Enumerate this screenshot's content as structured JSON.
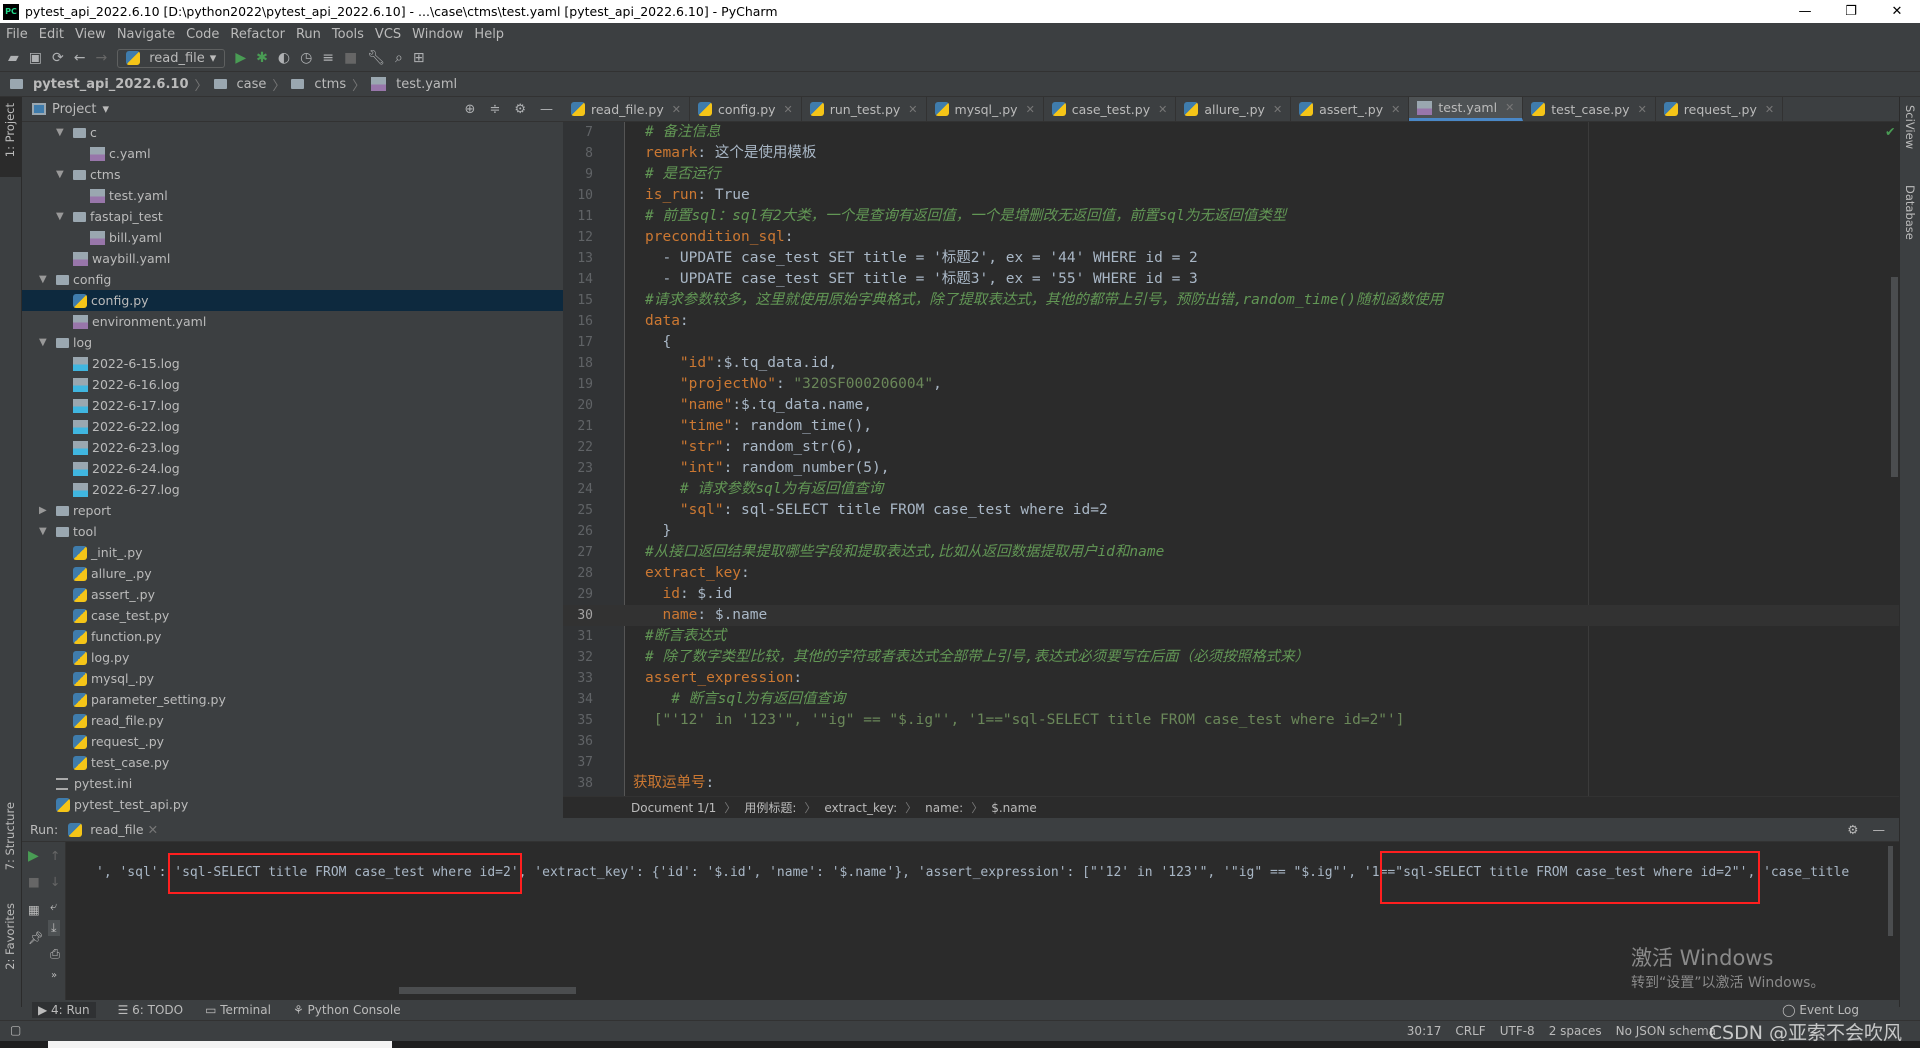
{
  "window": {
    "title": "pytest_api_2022.6.10 [D:\\python2022\\pytest_api_2022.6.10] - ...\\case\\ctms\\test.yaml [pytest_api_2022.6.10] - PyCharm",
    "logo": "PC"
  },
  "menu": [
    "File",
    "Edit",
    "View",
    "Navigate",
    "Code",
    "Refactor",
    "Run",
    "Tools",
    "VCS",
    "Window",
    "Help"
  ],
  "toolbar": {
    "run_config": "read_file"
  },
  "navbar": {
    "project": "pytest_api_2022.6.10",
    "crumbs": [
      "case",
      "ctms",
      "test.yaml"
    ]
  },
  "leftstrip": {
    "project": "1: Project",
    "structure": "7: Structure",
    "favorites": "2: Favorites"
  },
  "rightstrip": {
    "sciview": "SciView",
    "database": "Database"
  },
  "project_panel": {
    "title": "Project"
  },
  "tree": [
    {
      "label": "c",
      "depth": 2,
      "type": "folder",
      "open": true
    },
    {
      "label": "c.yaml",
      "depth": 3,
      "type": "yaml"
    },
    {
      "label": "ctms",
      "depth": 2,
      "type": "folder",
      "open": true
    },
    {
      "label": "test.yaml",
      "depth": 3,
      "type": "yaml"
    },
    {
      "label": "fastapi_test",
      "depth": 2,
      "type": "folder",
      "open": true
    },
    {
      "label": "bill.yaml",
      "depth": 3,
      "type": "yaml"
    },
    {
      "label": "waybill.yaml",
      "depth": 2,
      "type": "yaml"
    },
    {
      "label": "config",
      "depth": 1,
      "type": "folder",
      "open": true
    },
    {
      "label": "config.py",
      "depth": 2,
      "type": "py",
      "selected": true
    },
    {
      "label": "environment.yaml",
      "depth": 2,
      "type": "yaml"
    },
    {
      "label": "log",
      "depth": 1,
      "type": "folder",
      "open": true
    },
    {
      "label": "2022-6-15.log",
      "depth": 2,
      "type": "log"
    },
    {
      "label": "2022-6-16.log",
      "depth": 2,
      "type": "log"
    },
    {
      "label": "2022-6-17.log",
      "depth": 2,
      "type": "log"
    },
    {
      "label": "2022-6-22.log",
      "depth": 2,
      "type": "log"
    },
    {
      "label": "2022-6-23.log",
      "depth": 2,
      "type": "log"
    },
    {
      "label": "2022-6-24.log",
      "depth": 2,
      "type": "log"
    },
    {
      "label": "2022-6-27.log",
      "depth": 2,
      "type": "log"
    },
    {
      "label": "report",
      "depth": 1,
      "type": "folder",
      "open": false
    },
    {
      "label": "tool",
      "depth": 1,
      "type": "folder",
      "open": true
    },
    {
      "label": "_init_.py",
      "depth": 2,
      "type": "py"
    },
    {
      "label": "allure_.py",
      "depth": 2,
      "type": "py"
    },
    {
      "label": "assert_.py",
      "depth": 2,
      "type": "py"
    },
    {
      "label": "case_test.py",
      "depth": 2,
      "type": "py"
    },
    {
      "label": "function.py",
      "depth": 2,
      "type": "py"
    },
    {
      "label": "log.py",
      "depth": 2,
      "type": "py"
    },
    {
      "label": "mysql_.py",
      "depth": 2,
      "type": "py"
    },
    {
      "label": "parameter_setting.py",
      "depth": 2,
      "type": "py"
    },
    {
      "label": "read_file.py",
      "depth": 2,
      "type": "py"
    },
    {
      "label": "request_.py",
      "depth": 2,
      "type": "py"
    },
    {
      "label": "test_case.py",
      "depth": 2,
      "type": "py"
    },
    {
      "label": "pytest.ini",
      "depth": 1,
      "type": "ini"
    },
    {
      "label": "pytest_test_api.py",
      "depth": 1,
      "type": "py"
    }
  ],
  "tabs": [
    {
      "label": "read_file.py",
      "type": "py"
    },
    {
      "label": "config.py",
      "type": "py"
    },
    {
      "label": "run_test.py",
      "type": "py"
    },
    {
      "label": "mysql_.py",
      "type": "py"
    },
    {
      "label": "case_test.py",
      "type": "py"
    },
    {
      "label": "allure_.py",
      "type": "py"
    },
    {
      "label": "assert_.py",
      "type": "py"
    },
    {
      "label": "test.yaml",
      "type": "yaml",
      "active": true
    },
    {
      "label": "test_case.py",
      "type": "py"
    },
    {
      "label": "request_.py",
      "type": "py"
    }
  ],
  "code": {
    "current_line": 30,
    "lines": [
      {
        "n": 7,
        "t": [
          [
            "c",
            "# 备注信息"
          ]
        ]
      },
      {
        "n": 8,
        "t": [
          [
            "k",
            "remark"
          ],
          [
            "p",
            ": 这个是使用模板"
          ]
        ]
      },
      {
        "n": 9,
        "t": [
          [
            "c",
            "# 是否运行"
          ]
        ]
      },
      {
        "n": 10,
        "t": [
          [
            "k",
            "is_run"
          ],
          [
            "p",
            ": True"
          ]
        ]
      },
      {
        "n": 11,
        "t": [
          [
            "c",
            "# 前置sql：sql有2大类，一个是查询有返回值，一个是增删改无返回值，前置sql为无返回值类型"
          ]
        ]
      },
      {
        "n": 12,
        "t": [
          [
            "k",
            "precondition_sql"
          ],
          [
            "p",
            ":"
          ]
        ]
      },
      {
        "n": 13,
        "t": [
          [
            "p",
            "  - UPDATE case_test SET title = '标题2', ex = '44' WHERE id = 2"
          ]
        ]
      },
      {
        "n": 14,
        "t": [
          [
            "p",
            "  - UPDATE case_test SET title = '标题3', ex = '55' WHERE id = 3"
          ]
        ]
      },
      {
        "n": 15,
        "t": [
          [
            "c",
            "#请求参数较多，这里就使用原始字典格式，除了提取表达式，其他的都带上引号，预防出错,random_time()随机函数使用"
          ]
        ]
      },
      {
        "n": 16,
        "t": [
          [
            "k",
            "data"
          ],
          [
            "p",
            ":"
          ]
        ]
      },
      {
        "n": 17,
        "t": [
          [
            "p",
            "  {"
          ]
        ]
      },
      {
        "n": 18,
        "t": [
          [
            "p",
            "    "
          ],
          [
            "k",
            "\"id\""
          ],
          [
            "p",
            ":$.tq_data.id,"
          ]
        ]
      },
      {
        "n": 19,
        "t": [
          [
            "p",
            "    "
          ],
          [
            "k",
            "\"projectNo\""
          ],
          [
            "p",
            ": "
          ],
          [
            "s",
            "\"320SF000206004\""
          ],
          [
            "p",
            ","
          ]
        ]
      },
      {
        "n": 20,
        "t": [
          [
            "p",
            "    "
          ],
          [
            "k",
            "\"name\""
          ],
          [
            "p",
            ":$.tq_data.name,"
          ]
        ]
      },
      {
        "n": 21,
        "t": [
          [
            "p",
            "    "
          ],
          [
            "k",
            "\"time\""
          ],
          [
            "p",
            ": random_time(),"
          ]
        ]
      },
      {
        "n": 22,
        "t": [
          [
            "p",
            "    "
          ],
          [
            "k",
            "\"str\""
          ],
          [
            "p",
            ": random_str(6),"
          ]
        ]
      },
      {
        "n": 23,
        "t": [
          [
            "p",
            "    "
          ],
          [
            "k",
            "\"int\""
          ],
          [
            "p",
            ": random_number(5),"
          ]
        ]
      },
      {
        "n": 24,
        "t": [
          [
            "p",
            "    "
          ],
          [
            "c",
            "# 请求参数sql为有返回值查询"
          ]
        ]
      },
      {
        "n": 25,
        "t": [
          [
            "p",
            "    "
          ],
          [
            "k",
            "\"sql\""
          ],
          [
            "p",
            ": sql-SELECT title FROM case_test where id=2"
          ]
        ]
      },
      {
        "n": 26,
        "t": [
          [
            "p",
            "  }"
          ]
        ]
      },
      {
        "n": 27,
        "t": [
          [
            "c",
            "#从接口返回结果提取哪些字段和提取表达式,比如从返回数据提取用户id和name"
          ]
        ]
      },
      {
        "n": 28,
        "t": [
          [
            "k",
            "extract_key"
          ],
          [
            "p",
            ":"
          ]
        ]
      },
      {
        "n": 29,
        "t": [
          [
            "p",
            "  "
          ],
          [
            "k",
            "id"
          ],
          [
            "p",
            ": $.id"
          ]
        ]
      },
      {
        "n": 30,
        "t": [
          [
            "p",
            "  "
          ],
          [
            "k",
            "name"
          ],
          [
            "p",
            ": $.name"
          ]
        ]
      },
      {
        "n": 31,
        "t": [
          [
            "c",
            "#断言表达式"
          ]
        ]
      },
      {
        "n": 32,
        "t": [
          [
            "c",
            "# 除了数字类型比较，其他的字符或者表达式全部带上引号,表达式必须要写在后面（必须按照格式来）"
          ]
        ]
      },
      {
        "n": 33,
        "t": [
          [
            "k",
            "assert_expression"
          ],
          [
            "p",
            ":"
          ]
        ]
      },
      {
        "n": 34,
        "t": [
          [
            "p",
            "   "
          ],
          [
            "c",
            "# 断言sql为有返回值查询"
          ]
        ]
      },
      {
        "n": 35,
        "t": [
          [
            "s",
            " [\"'12' in '123'\", '\"ig\" == \"$.ig\"', '1==\"sql-SELECT title FROM case_test where id=2\"']"
          ]
        ]
      },
      {
        "n": 36,
        "t": []
      },
      {
        "n": 37,
        "t": []
      },
      {
        "n": 38,
        "t": [
          [
            "k",
            "获取运单号"
          ],
          [
            "p",
            ":"
          ]
        ]
      }
    ]
  },
  "editor_breadcrumb": [
    "Document 1/1",
    "用例标题:",
    "extract_key:",
    "name:",
    "$.name"
  ],
  "run": {
    "label": "Run:",
    "tab": "read_file",
    "output_parts": [
      "', 'sql': ",
      "'sql-SELECT title FROM case_test where id=2'",
      ", 'extract_key': {'id': '$.id', 'name': '$.name'}, 'assert_expression': [\"'12' in '123'\", '\"ig\" == \"$.ig\"', '1==",
      "\"sql-SELECT title FROM case_test where id=2\"'",
      ", 'case_title"
    ]
  },
  "bottom_tabs": [
    "4: Run",
    "6: TODO",
    "Terminal",
    "Python Console"
  ],
  "watermark": {
    "line1": "激活 Windows",
    "line2": "转到“设置”以激活 Windows。",
    "csdn": "CSDN @亚索不会吹风"
  },
  "status": {
    "event_log": "Event Log",
    "position": "30:17",
    "line_sep": "CRLF",
    "encoding": "UTF-8",
    "indent": "2 spaces",
    "schema": "No JSON schema"
  },
  "colors": {
    "highlight_box": "#ff1f1f",
    "keyword": "#cc7832",
    "comment": "#629755",
    "string": "#6a8759",
    "text": "#a9b7c6"
  }
}
